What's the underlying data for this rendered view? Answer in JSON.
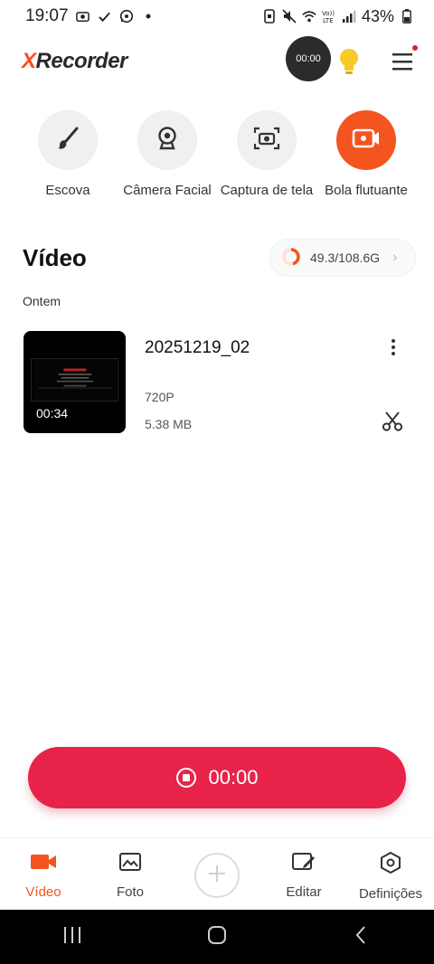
{
  "status_bar": {
    "time": "19:07",
    "battery_percent": "43%"
  },
  "header": {
    "logo_x": "X",
    "logo_rest": "Recorder",
    "float_timer": "00:00"
  },
  "tools": [
    {
      "label": "Escova",
      "icon": "brush-icon"
    },
    {
      "label": "Câmera Facial",
      "icon": "webcam-icon"
    },
    {
      "label": "Captura de tela",
      "icon": "screenshot-icon"
    },
    {
      "label": "Bola flutuante",
      "icon": "video-camera-icon",
      "active": true
    }
  ],
  "video_section": {
    "title": "Vídeo",
    "storage": "49.3/108.6G",
    "storage_used_fraction": 0.454,
    "date_group": "Ontem"
  },
  "videos": [
    {
      "name": "20251219_02",
      "resolution": "720P",
      "size": "5.38 MB",
      "duration": "00:34"
    }
  ],
  "record_button": {
    "time": "00:00"
  },
  "bottom_nav": {
    "video": "Vídeo",
    "photo": "Foto",
    "edit": "Editar",
    "settings": "Definições"
  },
  "colors": {
    "accent": "#f4541f",
    "record": "#e8234a"
  }
}
